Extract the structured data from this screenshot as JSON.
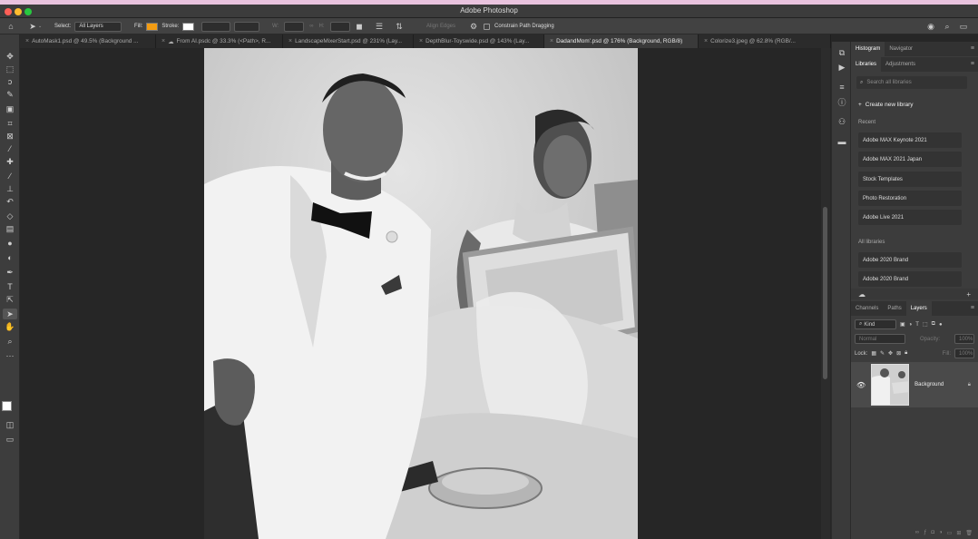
{
  "window": {
    "title": "Adobe Photoshop"
  },
  "options_bar": {
    "select_label": "Select:",
    "select_value": "All Layers",
    "fill_label": "Fill:",
    "stroke_label": "Stroke:",
    "align_edges": "Align Edges",
    "constrain": "Constrain Path Dragging",
    "fill_color": "#f39c12"
  },
  "tabs": [
    {
      "label": "AutoMask1.psd @ 49.5% (Background ..."
    },
    {
      "label": "From AI.psdc @ 33.3% (<Path>, R..."
    },
    {
      "label": "LandscapeMixerStart.psd @ 231% (Lay..."
    },
    {
      "label": "DepthBlur-Toyswide.psd @ 143% (Lay..."
    },
    {
      "label": "DadandMom'.psd @ 176% (Background, RGB/8)"
    },
    {
      "label": "Colorize3.jpeg @ 62.8% (RGB/..."
    }
  ],
  "panel_top": {
    "tabs": [
      "Histogram",
      "Navigator"
    ]
  },
  "libraries": {
    "tabs": [
      "Libraries",
      "Adjustments"
    ],
    "search_placeholder": "Search all libraries",
    "create_label": "Create new library",
    "recent_heading": "Recent",
    "recent": [
      "Adobe MAX Keynote 2021",
      "Adobe MAX 2021 Japan",
      "Stock Templates",
      "Photo Restoration",
      "Adobe Live 2021"
    ],
    "all_heading": "All libraries",
    "all": [
      "Adobe 2020 Brand",
      "Adobe 2020 Brand"
    ]
  },
  "layers_panel": {
    "tabs": [
      "Channels",
      "Paths",
      "Layers"
    ],
    "filter": "Kind",
    "blend": "Normal",
    "opacity_label": "Opacity:",
    "opacity_value": "100%",
    "lock_label": "Lock:",
    "fill_label": "Fill:",
    "fill_value": "100%",
    "layers": [
      {
        "name": "Background"
      }
    ]
  }
}
